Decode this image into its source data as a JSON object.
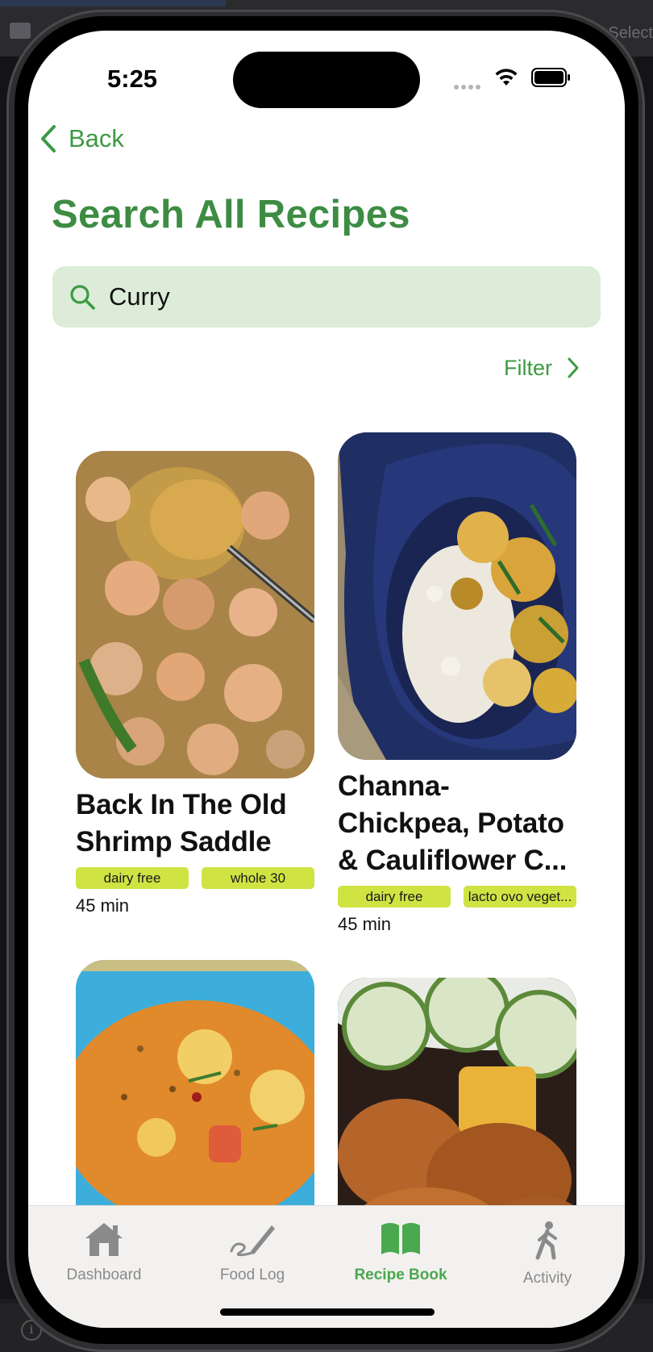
{
  "status": {
    "time": "5:25"
  },
  "nav": {
    "back_label": "Back"
  },
  "page": {
    "title": "Search All Recipes"
  },
  "search": {
    "value": "Curry",
    "placeholder": "Search"
  },
  "filter": {
    "label": "Filter"
  },
  "recipes": [
    {
      "title": "Back In The Old Shrimp Saddle",
      "tags": [
        "dairy free",
        "whole 30"
      ],
      "duration": "45 min"
    },
    {
      "title": "Channa-Chickpea, Potato & Cauliflower C...",
      "tags": [
        "dairy free",
        "lacto ovo veget..."
      ],
      "duration": "45 min"
    },
    {
      "title": "",
      "tags": [],
      "duration": ""
    },
    {
      "title": "",
      "tags": [],
      "duration": ""
    }
  ],
  "tabs": [
    {
      "label": "Dashboard",
      "icon": "house-icon"
    },
    {
      "label": "Food Log",
      "icon": "pencil-icon"
    },
    {
      "label": "Recipe Book",
      "icon": "book-icon",
      "active": true
    },
    {
      "label": "Activity",
      "icon": "walking-person-icon"
    }
  ],
  "colors": {
    "accent": "#3d9a43",
    "search_bg": "#dcecd8",
    "tag_bg": "#cfe443",
    "tab_inactive": "#8a8a8a"
  },
  "desktop": {
    "select_hint": "Select"
  }
}
